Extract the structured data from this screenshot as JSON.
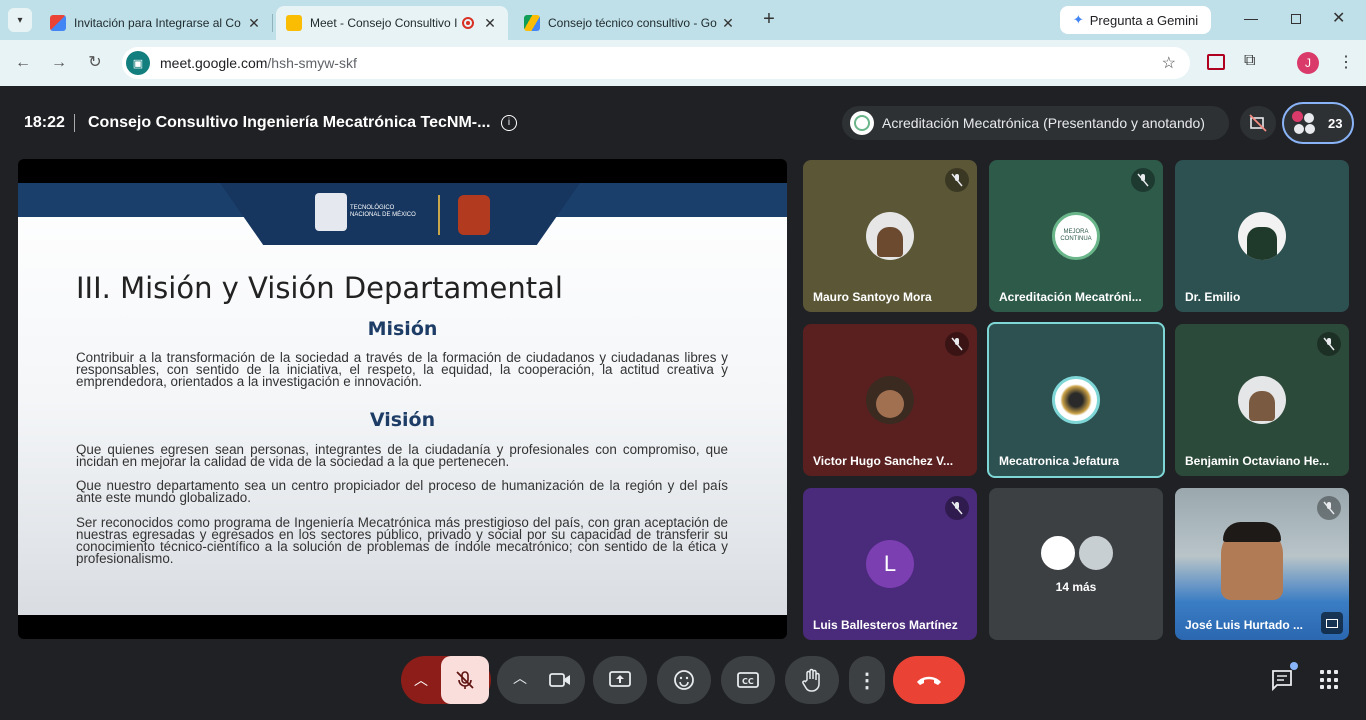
{
  "browser": {
    "tabs": [
      {
        "title": "Invitación para Integrarse al Co",
        "icon": "gmail-icon"
      },
      {
        "title": "Meet - Consejo Consultivo I",
        "icon": "meet-icon"
      },
      {
        "title": "Consejo técnico consultivo - Go",
        "icon": "drive-icon"
      }
    ],
    "gemini_label": "Pregunta a Gemini",
    "url_host": "meet.google.com",
    "url_path": "/hsh-smyw-skf",
    "profile_initial": "J"
  },
  "meeting": {
    "time": "18:22",
    "title": "Consejo Consultivo Ingeniería Mecatrónica TecNM-...",
    "presenting": "Acreditación Mecatrónica (Presentando y anotando)",
    "participants_count": "23"
  },
  "slide": {
    "logo_text": "TECNOLÓGICO NACIONAL DE MÉXICO",
    "title": "III. Misión y Visión Departamental",
    "mision_heading": "Misión",
    "mision_text": "Contribuir a la transformación de la sociedad a través de la formación de ciudadanos y ciudadanas libres y responsables, con sentido de la iniciativa, el respeto, la equidad, la cooperación, la actitud creativa y emprendedora, orientados a la investigación e innovación.",
    "vision_heading": "Visión",
    "vision_p1": "Que quienes egresen sean personas, integrantes de la ciudadanía y profesionales con compromiso, que incidan en mejorar la calidad de vida de la sociedad a la que pertenecen.",
    "vision_p2": "Que nuestro departamento sea un centro propiciador del proceso de humanización de la región y del país ante este mundo globalizado.",
    "vision_p3": "Ser reconocidos como programa de Ingeniería Mecatrónica más prestigioso del país, con gran aceptación de nuestras egresadas y egresados en los sectores público, privado y social por su capacidad de transferir su conocimiento técnico-científico a la solución de problemas de índole mecatrónico; con sentido de la ética y profesionalismo."
  },
  "participants": [
    {
      "name": "Mauro Santoyo Mora",
      "muted": true,
      "bg": "#5a5636"
    },
    {
      "name": "Acreditación Mecatróni...",
      "muted": true,
      "bg": "#2e5a4a",
      "avatar_text": "MEJORA CONTINUA"
    },
    {
      "name": "Dr. Emilio",
      "muted": false,
      "bg": "#2d5050"
    },
    {
      "name": "Victor Hugo Sanchez V...",
      "muted": true,
      "bg": "#5a2020"
    },
    {
      "name": "Mecatronica Jefatura",
      "muted": false,
      "bg": "#2d5050"
    },
    {
      "name": "Benjamin Octaviano He...",
      "muted": true,
      "bg": "#2c4a3a"
    },
    {
      "name": "Luis Ballesteros Martínez",
      "muted": true,
      "bg": "#4a2a7a",
      "initial": "L"
    },
    {
      "name": "14 más",
      "muted": false,
      "bg": "#3c4043"
    },
    {
      "name": "José Luis Hurtado ...",
      "muted": true,
      "bg": "#8a9aa0"
    }
  ]
}
